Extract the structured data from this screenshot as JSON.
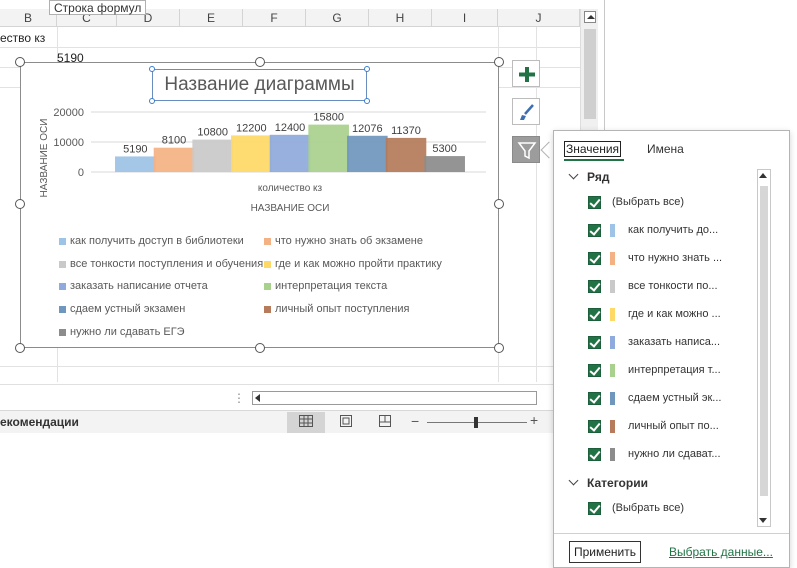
{
  "tooltip": "Строка формул",
  "columns": [
    "B",
    "C",
    "D",
    "E",
    "F",
    "G",
    "H",
    "I",
    "J"
  ],
  "cells": {
    "a1": "ество кз",
    "b2": "5190"
  },
  "statusbar": {
    "text": "екомендации",
    "zoom_minus": "−",
    "zoom_plus": "+"
  },
  "chart": {
    "title": "Название диаграммы"
  },
  "chart_data": {
    "type": "bar",
    "categories": [
      "количество кз"
    ],
    "xlabel": "НАЗВАНИЕ ОСИ",
    "ylabel": "НАЗВАНИЕ ОСИ",
    "ylim": [
      0,
      20000
    ],
    "yticks": [
      0,
      10000,
      20000
    ],
    "ytick_labels": [
      "0",
      "10000",
      "20000"
    ],
    "grid": true,
    "legend_position": "bottom",
    "series": [
      {
        "name": "как получить доступ в библиотеки",
        "values": [
          5190
        ],
        "color": "#9dc3e6"
      },
      {
        "name": "что нужно знать об экзамене",
        "values": [
          8100
        ],
        "color": "#f4b183"
      },
      {
        "name": "все тонкости поступления и обучения",
        "values": [
          10800
        ],
        "color": "#c9c9c9"
      },
      {
        "name": "где и как можно пройти практику",
        "values": [
          12200
        ],
        "color": "#ffd966"
      },
      {
        "name": "заказать написание отчета",
        "values": [
          12400
        ],
        "color": "#8faadc"
      },
      {
        "name": "интерпретация текста",
        "values": [
          15800
        ],
        "color": "#a9d18e"
      },
      {
        "name": "сдаем устный экзамен",
        "values": [
          12076
        ],
        "color": "#6f97bd"
      },
      {
        "name": "личный опыт поступления",
        "values": [
          11370
        ],
        "color": "#b57b5a"
      },
      {
        "name": "нужно ли сдавать ЕГЭ",
        "values": [
          5300
        ],
        "color": "#8c8c8c"
      }
    ],
    "data_labels": [
      "5190",
      "8100",
      "10800",
      "12200",
      "12400",
      "15800",
      "12076",
      "11370",
      "5300"
    ]
  },
  "filter_pane": {
    "tab_values": "Значения",
    "tab_names": "Имена",
    "series_group": "Ряд",
    "select_all": "(Выбрать все)",
    "series_items": [
      "как получить до...",
      "что нужно знать ...",
      "все тонкости по...",
      "где и как можно ...",
      "заказать написа...",
      "интерпретация т...",
      "сдаем устный эк...",
      "личный опыт по...",
      "нужно ли сдават..."
    ],
    "categories_group": "Категории",
    "categories_select_all": "(Выбрать все)",
    "apply": "Применить",
    "select_data": "Выбрать данные..."
  }
}
